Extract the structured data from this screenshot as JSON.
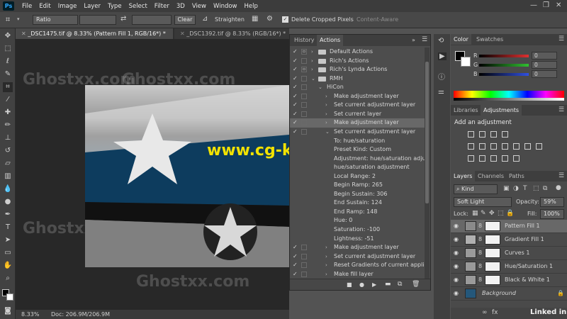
{
  "app": {
    "logo": "Ps"
  },
  "menu": [
    "File",
    "Edit",
    "Image",
    "Layer",
    "Type",
    "Select",
    "Filter",
    "3D",
    "View",
    "Window",
    "Help"
  ],
  "options_bar": {
    "ratio_value": "Ratio",
    "clear_label": "Clear",
    "straighten_label": "Straighten",
    "delete_cropped_label": "Delete Cropped Pixels",
    "content_aware_label": "Content-Aware"
  },
  "document_tabs": [
    {
      "label": "_DSC1475.tif @ 8.33% (Pattern Fill 1, RGB/16*) *",
      "active": true
    },
    {
      "label": "_DSC1392.tif @ 8.33% (RGB/16*) *",
      "active": false
    }
  ],
  "status_bar": {
    "zoom": "8.33%",
    "doc_info": "Doc: 206.9M/206.9M"
  },
  "watermarks": {
    "main": "www.cg-ku.com",
    "ghost": "Ghostxx.com"
  },
  "actions_panel": {
    "tabs": [
      "History",
      "Actions"
    ],
    "rows": [
      {
        "text": "Default Actions",
        "type": "set",
        "checked": true,
        "dialog": true
      },
      {
        "text": "Rich's Actions",
        "type": "set",
        "checked": true,
        "dialog": false
      },
      {
        "text": "Rich's Lynda Actions",
        "type": "set",
        "checked": true,
        "dialog": true
      },
      {
        "text": "RMH",
        "type": "set-open",
        "checked": true,
        "dialog": false
      },
      {
        "text": "HiCon",
        "type": "action-open",
        "checked": true,
        "dialog": false
      },
      {
        "text": "Make adjustment layer",
        "type": "step",
        "checked": true
      },
      {
        "text": "Set current adjustment layer",
        "type": "step",
        "checked": true
      },
      {
        "text": "Set current layer",
        "type": "step",
        "checked": true
      },
      {
        "text": "Make adjustment layer",
        "type": "step",
        "checked": true,
        "selected": true
      },
      {
        "text": "Set current adjustment layer",
        "type": "step-open",
        "checked": true
      },
      {
        "text": "To: hue/saturation",
        "type": "detail"
      },
      {
        "text": "Preset Kind: Custom",
        "type": "detail"
      },
      {
        "text": "Adjustment: hue/saturation adjust...",
        "type": "detail"
      },
      {
        "text": "hue/saturation adjustment",
        "type": "detail"
      },
      {
        "text": "Local Range: 2",
        "type": "detail"
      },
      {
        "text": "Begin Ramp: 265",
        "type": "detail"
      },
      {
        "text": "Begin Sustain: 306",
        "type": "detail"
      },
      {
        "text": "End Sustain: 124",
        "type": "detail"
      },
      {
        "text": "End Ramp: 148",
        "type": "detail"
      },
      {
        "text": "Hue: 0",
        "type": "detail"
      },
      {
        "text": "Saturation: -100",
        "type": "detail"
      },
      {
        "text": "Lightness: -51",
        "type": "detail"
      },
      {
        "text": "Make adjustment layer",
        "type": "step",
        "checked": true
      },
      {
        "text": "Set current adjustment layer",
        "type": "step",
        "checked": true
      },
      {
        "text": "Reset Gradients of current applicat...",
        "type": "step",
        "checked": true
      },
      {
        "text": "Make fill layer",
        "type": "step",
        "checked": true
      }
    ]
  },
  "color_panel": {
    "tabs": [
      "Color",
      "Swatches"
    ],
    "channels": [
      {
        "label": "R",
        "value": "0",
        "color": "#e03030"
      },
      {
        "label": "G",
        "value": "0",
        "color": "#30c030"
      },
      {
        "label": "B",
        "value": "0",
        "color": "#3050e0"
      }
    ]
  },
  "adjustments_panel": {
    "tabs": [
      "Libraries",
      "Adjustments"
    ],
    "heading": "Add an adjustment"
  },
  "layers_panel": {
    "tabs": [
      "Layers",
      "Channels",
      "Paths"
    ],
    "filter_kind": "Kind",
    "blend_mode": "Soft Light",
    "opacity_label": "Opacity:",
    "opacity_value": "59%",
    "lock_label": "Lock:",
    "fill_label": "Fill:",
    "fill_value": "100%",
    "layers": [
      {
        "name": "Pattern Fill 1",
        "selected": true,
        "thumb": "#8a8a8a"
      },
      {
        "name": "Gradient Fill 1",
        "selected": false,
        "thumb": "#b0b0b0"
      },
      {
        "name": "Curves 1",
        "selected": false,
        "thumb": "#9a9a9a"
      },
      {
        "name": "Hue/Saturation 1",
        "selected": false,
        "thumb": "#9a9a9a"
      },
      {
        "name": "Black & White 1",
        "selected": false,
        "thumb": "#9a9a9a"
      },
      {
        "name": "Background",
        "selected": false,
        "thumb": "#24577a",
        "italic": true
      }
    ]
  },
  "branding": {
    "linkedin": "Linked in"
  }
}
